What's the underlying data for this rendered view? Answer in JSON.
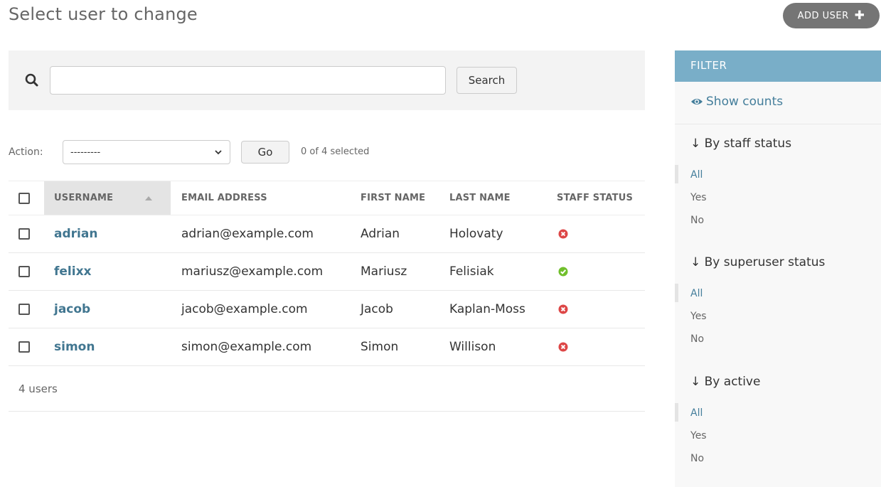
{
  "header": {
    "title": "Select user to change",
    "add_user_label": "ADD USER"
  },
  "search": {
    "value": "",
    "placeholder": "",
    "button_label": "Search"
  },
  "actions": {
    "label": "Action:",
    "selected_option": "---------",
    "go_label": "Go",
    "selection_status": "0 of 4 selected"
  },
  "table": {
    "columns": [
      "USERNAME",
      "EMAIL ADDRESS",
      "FIRST NAME",
      "LAST NAME",
      "STAFF STATUS"
    ],
    "sorted_column": "USERNAME",
    "rows": [
      {
        "username": "adrian",
        "email": "adrian@example.com",
        "first_name": "Adrian",
        "last_name": "Holovaty",
        "staff": false
      },
      {
        "username": "felixx",
        "email": "mariusz@example.com",
        "first_name": "Mariusz",
        "last_name": "Felisiak",
        "staff": true
      },
      {
        "username": "jacob",
        "email": "jacob@example.com",
        "first_name": "Jacob",
        "last_name": "Kaplan-Moss",
        "staff": false
      },
      {
        "username": "simon",
        "email": "simon@example.com",
        "first_name": "Simon",
        "last_name": "Willison",
        "staff": false
      }
    ],
    "result_count": "4 users"
  },
  "filter": {
    "header": "FILTER",
    "show_counts_label": "Show counts",
    "groups": [
      {
        "title": "↓ By staff status",
        "options": [
          "All",
          "Yes",
          "No"
        ],
        "selected": "All"
      },
      {
        "title": "↓ By superuser status",
        "options": [
          "All",
          "Yes",
          "No"
        ],
        "selected": "All"
      },
      {
        "title": "↓ By active",
        "options": [
          "All",
          "Yes",
          "No"
        ],
        "selected": "All"
      }
    ]
  },
  "colors": {
    "link": "#417690",
    "filter_header": "#79aec8",
    "status_yes": "#70bf2b",
    "status_no": "#dd4646"
  },
  "icons": {
    "search": "magnifier-icon",
    "add": "plus-icon",
    "show_counts": "eye-icon",
    "status_yes": "check-circle-icon",
    "status_no": "x-circle-icon"
  }
}
